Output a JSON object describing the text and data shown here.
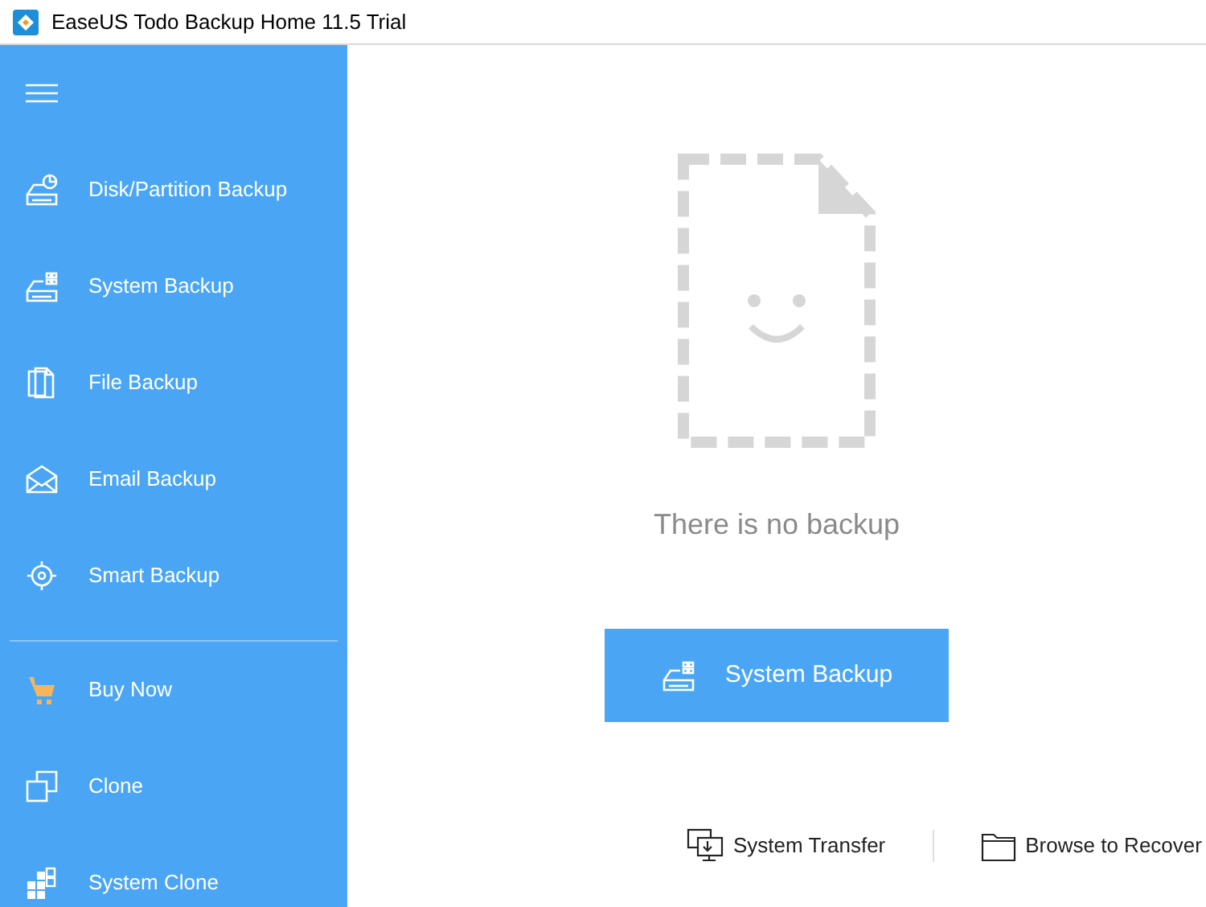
{
  "window": {
    "title": "EaseUS Todo Backup Home 11.5 Trial"
  },
  "sidebar": {
    "backup_items": [
      {
        "label": "Disk/Partition Backup"
      },
      {
        "label": "System Backup"
      },
      {
        "label": "File Backup"
      },
      {
        "label": "Email Backup"
      },
      {
        "label": "Smart Backup"
      }
    ],
    "tool_items": [
      {
        "label": "Buy Now"
      },
      {
        "label": "Clone"
      },
      {
        "label": "System Clone"
      }
    ]
  },
  "main": {
    "empty_message": "There is no backup",
    "primary_button": "System Backup",
    "links": [
      "System Transfer",
      "Browse to Recover"
    ]
  }
}
